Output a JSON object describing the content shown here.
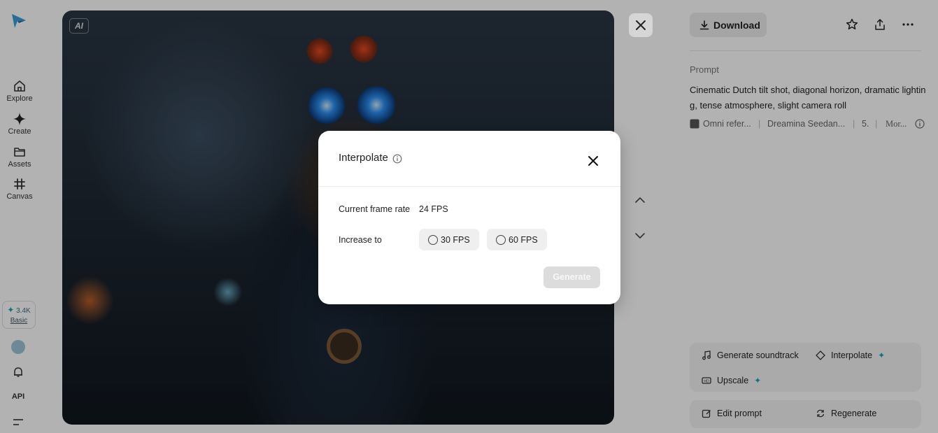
{
  "sidebar": {
    "items": [
      {
        "label": "Explore",
        "icon": "home-icon"
      },
      {
        "label": "Create",
        "icon": "sparkle-icon"
      },
      {
        "label": "Assets",
        "icon": "folder-icon"
      },
      {
        "label": "Canvas",
        "icon": "canvas-icon"
      }
    ],
    "credits": {
      "amount": "3.4K",
      "plan": "Basic"
    },
    "api_label": "API"
  },
  "media": {
    "badge": "AI"
  },
  "panel": {
    "download_label": "Download",
    "prompt_label": "Prompt",
    "prompt_text": "Cinematic Dutch tilt shot, diagonal horizon, dramatic lighting, tense atmosphere, slight camera roll",
    "meta": {
      "reference": "Omni refer...",
      "model": "Dreamina Seedan...",
      "duration": "5.",
      "more": "Mor..."
    },
    "actions": {
      "soundtrack": "Generate soundtrack",
      "interpolate": "Interpolate",
      "upscale": "Upscale",
      "edit_prompt": "Edit prompt",
      "regenerate": "Regenerate"
    }
  },
  "modal": {
    "title": "Interpolate",
    "current_label": "Current frame rate",
    "current_value": "24 FPS",
    "increase_label": "Increase to",
    "options": [
      "30 FPS",
      "60 FPS"
    ],
    "generate_label": "Generate"
  },
  "colors": {
    "accent": "#1aa3b8",
    "overlay": "rgba(0,0,0,0.30)"
  }
}
